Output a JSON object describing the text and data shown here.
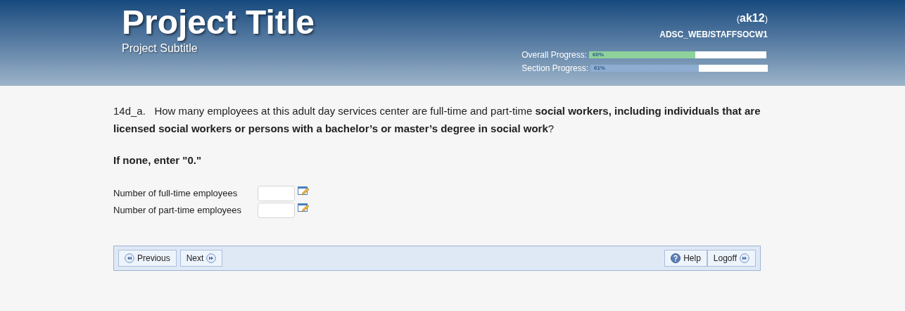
{
  "header": {
    "title": "Project Title",
    "subtitle": "Project Subtitle",
    "user": "(**ak12**)",
    "instrument": "ADSC_WEB/STAFFSOCW1",
    "progress": [
      {
        "label": "Overall Progress:",
        "level": 0.6,
        "reading": "60%",
        "color": "#8fd19a"
      },
      {
        "label": "Section Progress:",
        "level": 0.61,
        "reading": "61%",
        "color": "#8fadd0"
      }
    ]
  },
  "question": {
    "number": "14d_a.",
    "text": "How many employees at this adult day services center are full-time and part-time **social workers, including individuals that are licensed social workers or persons with a bachelor’s or master’s degree in social work**?",
    "instruction": "If none, enter \"0.\""
  },
  "fields": [
    {
      "label": "Number of full-time employees"
    },
    {
      "label": "Number of part-time employees"
    }
  ],
  "nav": {
    "left": [
      {
        "label": "Previous",
        "kind": "back"
      },
      {
        "label": "Next",
        "kind": "forward"
      }
    ],
    "right": [
      {
        "label": "Help",
        "kind": "help"
      },
      {
        "label": "Logoff",
        "kind": "forward"
      }
    ]
  }
}
